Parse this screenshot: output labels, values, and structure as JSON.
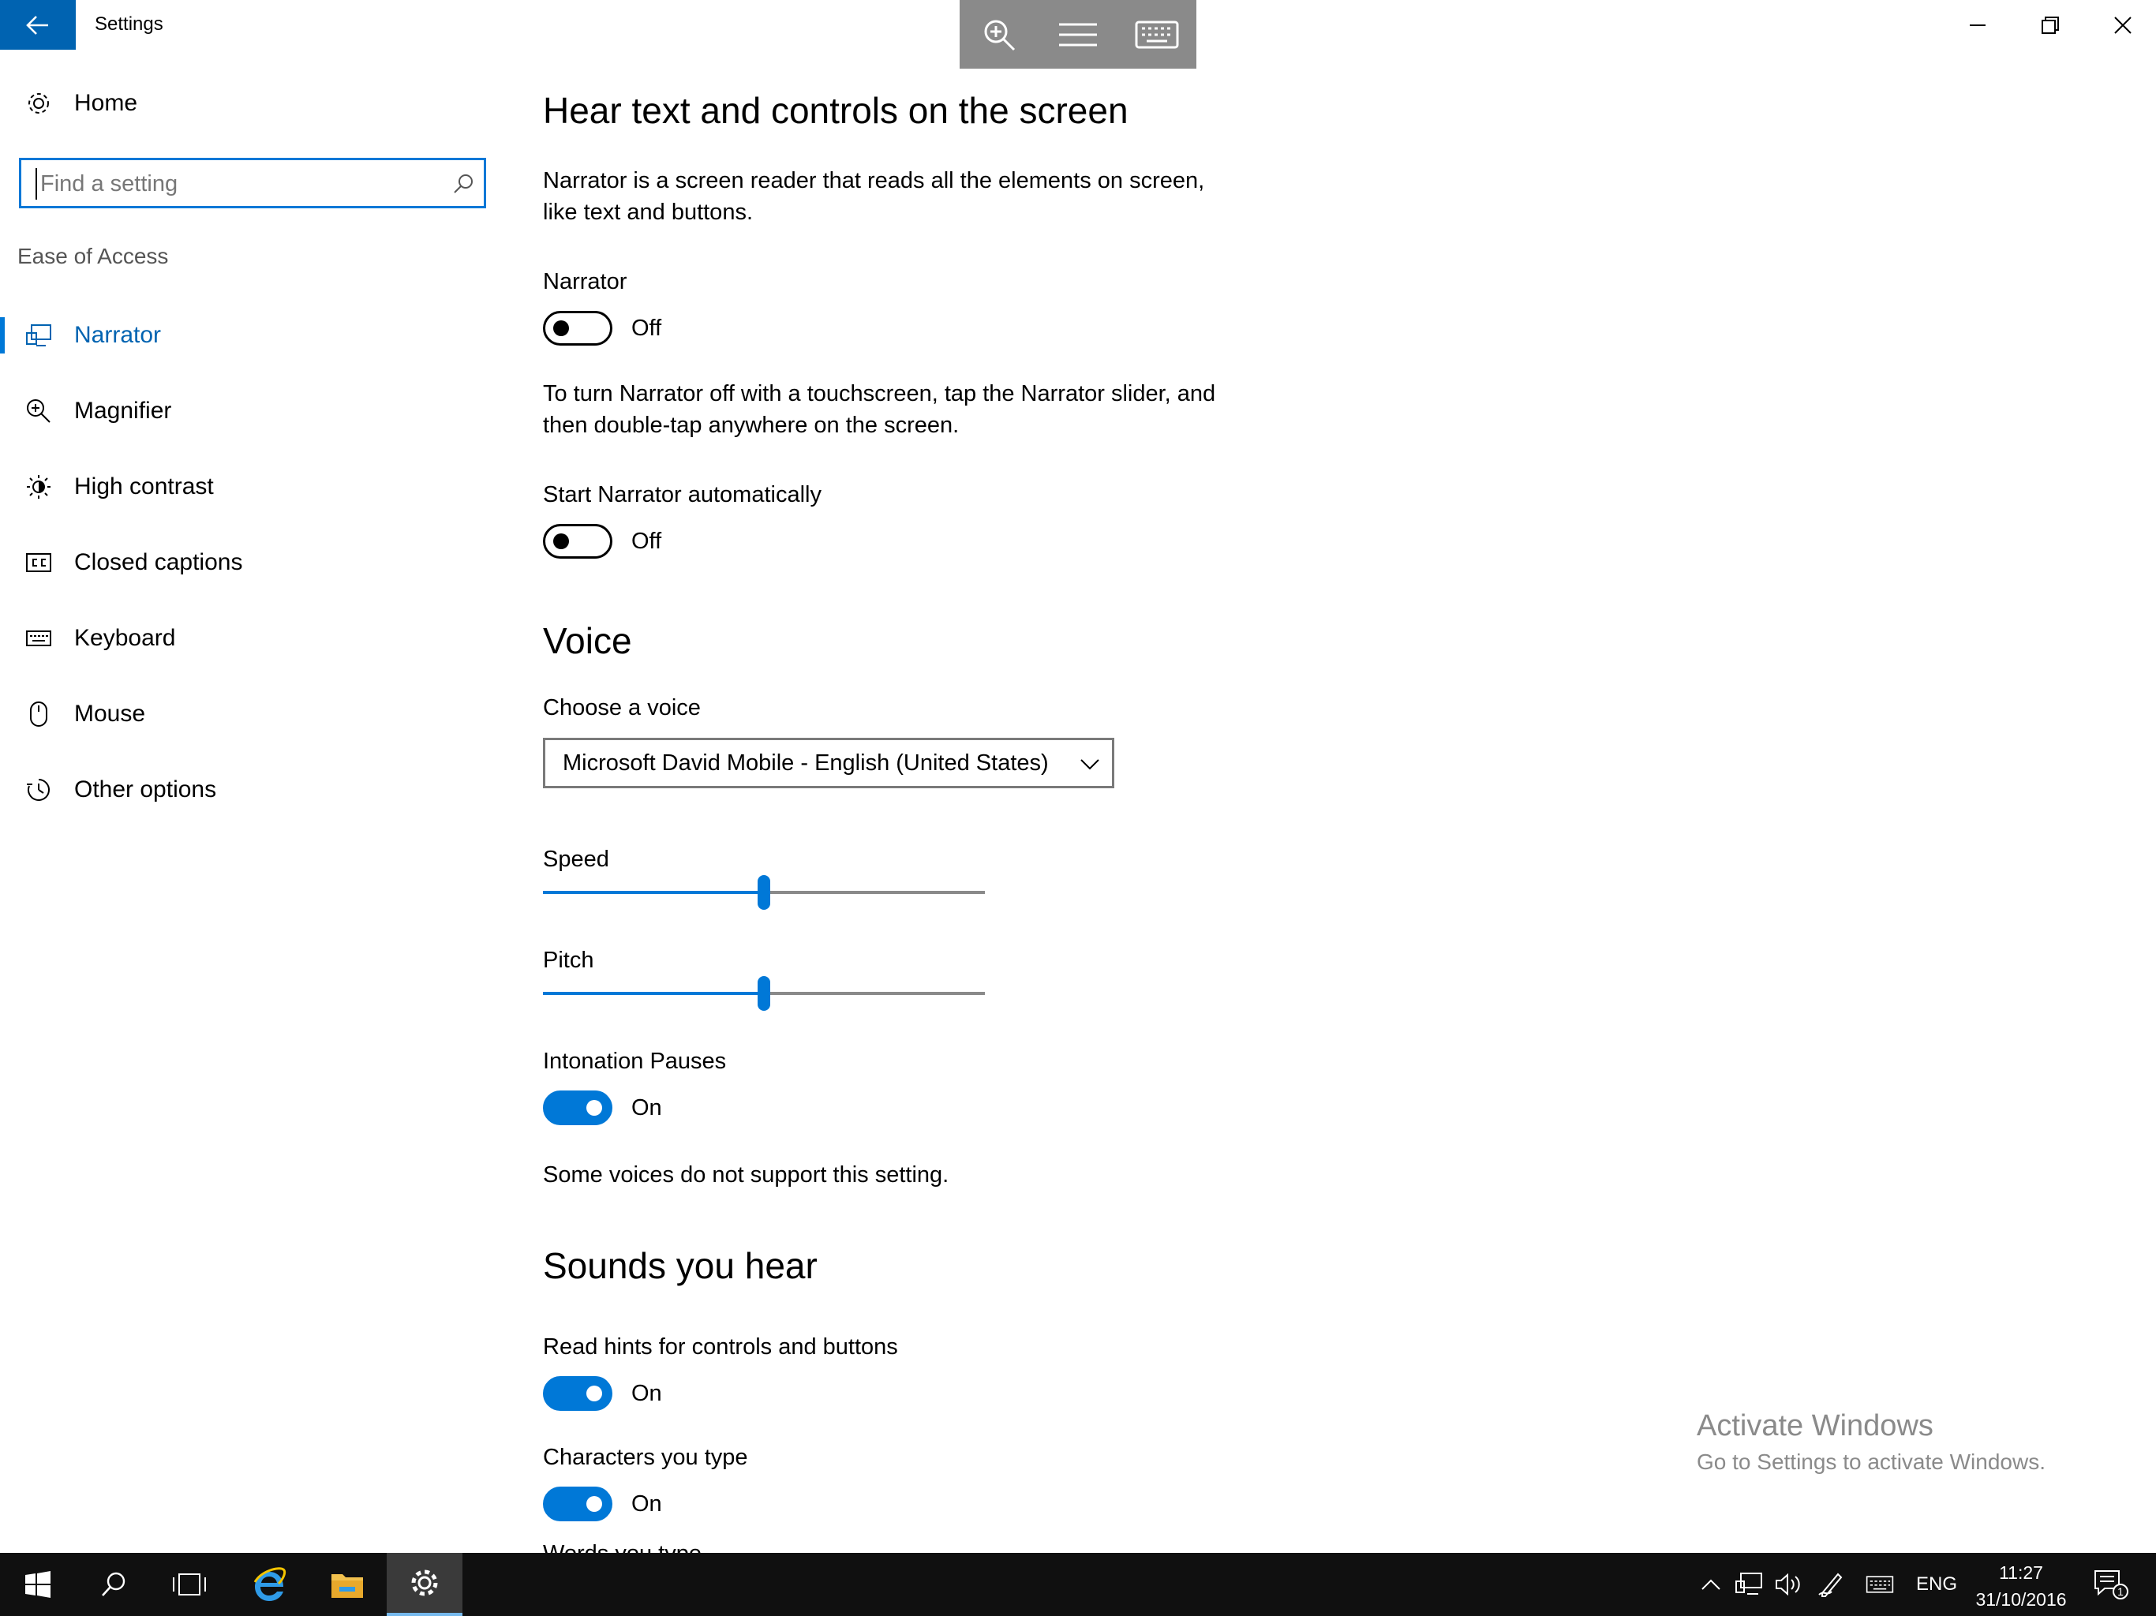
{
  "window": {
    "title": "Settings"
  },
  "sidebar": {
    "home_label": "Home",
    "search_placeholder": "Find a setting",
    "group_label": "Ease of Access",
    "items": [
      {
        "label": "Narrator",
        "icon": "narrator-icon",
        "active": true
      },
      {
        "label": "Magnifier",
        "icon": "magnifier-icon",
        "active": false
      },
      {
        "label": "High contrast",
        "icon": "high-contrast-icon",
        "active": false
      },
      {
        "label": "Closed captions",
        "icon": "closed-captions-icon",
        "active": false
      },
      {
        "label": "Keyboard",
        "icon": "keyboard-icon",
        "active": false
      },
      {
        "label": "Mouse",
        "icon": "mouse-icon",
        "active": false
      },
      {
        "label": "Other options",
        "icon": "other-options-icon",
        "active": false
      }
    ]
  },
  "main": {
    "section1_title": "Hear text and controls on the screen",
    "intro_line1": "Narrator is a screen reader that reads all the elements on screen,",
    "intro_line2": "like text and buttons.",
    "narrator_label": "Narrator",
    "narrator_state": "Off",
    "touch_note_line1": "To turn Narrator off with a touchscreen, tap the Narrator slider, and",
    "touch_note_line2": "then double-tap anywhere on the screen.",
    "start_auto_label": "Start Narrator automatically",
    "start_auto_state": "Off",
    "section2_title": "Voice",
    "choose_voice_label": "Choose a voice",
    "voice_value": "Microsoft David Mobile - English (United States)",
    "speed_label": "Speed",
    "speed_value": 0.5,
    "pitch_label": "Pitch",
    "pitch_value": 0.5,
    "intonation_label": "Intonation Pauses",
    "intonation_state": "On",
    "voices_note": "Some voices do not support this setting.",
    "section3_title": "Sounds you hear",
    "read_hints_label": "Read hints for controls and buttons",
    "read_hints_state": "On",
    "chars_label": "Characters you type",
    "chars_state": "On",
    "cutoff_label": "Words you type"
  },
  "watermark": {
    "line1": "Activate Windows",
    "line2": "Go to Settings to activate Windows."
  },
  "taskbar": {
    "language": "ENG",
    "time": "11:27",
    "date": "31/10/2016",
    "notification_count": "1"
  },
  "colors": {
    "accent": "#0078d7",
    "accent_dark": "#0063b1",
    "taskbar": "#101010"
  }
}
